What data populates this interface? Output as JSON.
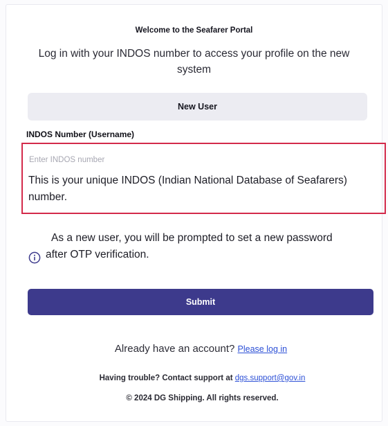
{
  "header": {
    "welcome": "Welcome to the Seafarer Portal",
    "subtitle": "Log in with your INDOS number to access your profile on the new system"
  },
  "new_user_button": {
    "label": "New User"
  },
  "indos_field": {
    "label": "INDOS Number (Username)",
    "placeholder": "Enter INDOS number",
    "value": "",
    "help_text": "This is your unique INDOS (Indian National Database of Seafarers) number."
  },
  "info": {
    "icon": "info-icon",
    "line1": "As a new user, you will be prompted to set a new password",
    "line2": "after OTP verification."
  },
  "submit_button": {
    "label": "Submit"
  },
  "footer": {
    "already_text": "Already have an account?",
    "login_link": "Please log in",
    "trouble_text": "Having trouble? Contact support at",
    "support_email": "dgs.support@gov.in",
    "copyright": "© 2024 DG Shipping. All rights reserved."
  },
  "colors": {
    "primary": "#3d3a8c",
    "highlight_border": "#d32a4a",
    "link": "#2b4fd6",
    "secondary_button": "#ececf2"
  }
}
